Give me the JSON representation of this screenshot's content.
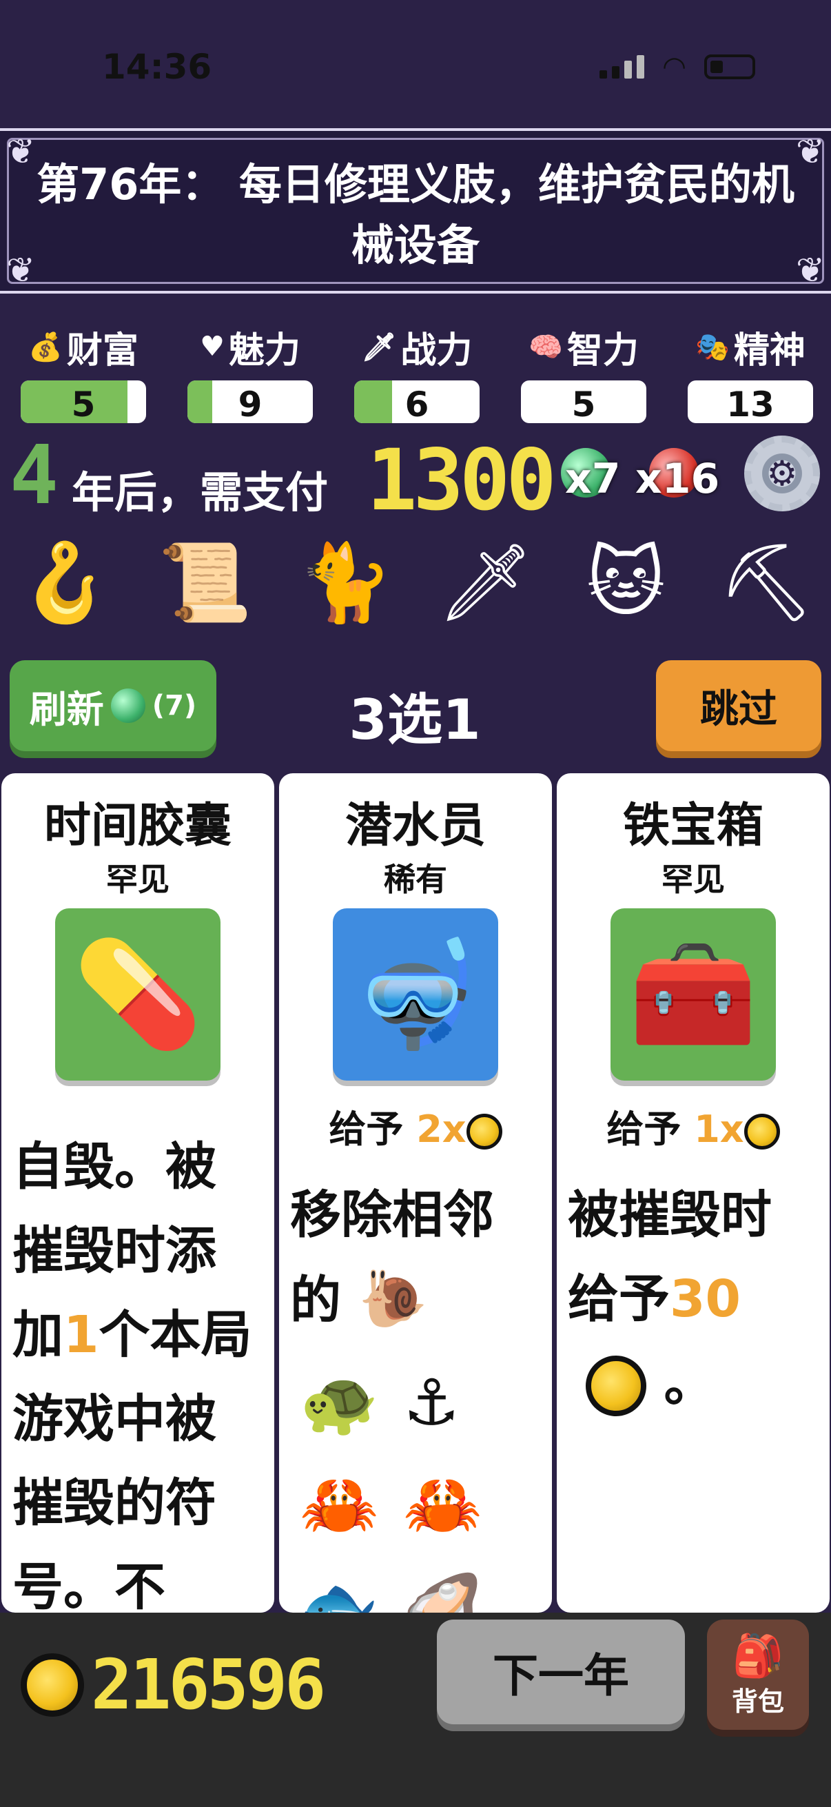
{
  "status_bar": {
    "time": "14:36",
    "icons": [
      "signal-icon",
      "wifi-icon",
      "battery-icon"
    ]
  },
  "banner": {
    "title": "第76年： 每日修理义肢，维护贫民的机械设备"
  },
  "stats": [
    {
      "label": "财富",
      "icon": "money-bag-icon",
      "value": "5",
      "fill_fraction": 0.85
    },
    {
      "label": "魅力",
      "icon": "heart-icon",
      "value": "9",
      "fill_fraction": 0.2
    },
    {
      "label": "战力",
      "icon": "sword-icon",
      "value": "6",
      "fill_fraction": 0.3
    },
    {
      "label": "智力",
      "icon": "brain-icon",
      "value": "5",
      "fill_fraction": 0
    },
    {
      "label": "精神",
      "icon": "mask-icon",
      "value": "13",
      "fill_fraction": 0
    }
  ],
  "payment": {
    "years": "4",
    "text": "年后，需支付",
    "amount": "1300",
    "green_multiplier": "x7",
    "red_multiplier": "x16"
  },
  "items": [
    {
      "name": "hook-tool-icon",
      "glyph": "🪝"
    },
    {
      "name": "wanted-poster-icon",
      "glyph": "📜"
    },
    {
      "name": "cyber-cat-icon",
      "glyph": "🐈"
    },
    {
      "name": "guillotine-icon",
      "glyph": "🗡"
    },
    {
      "name": "lucky-cat-icon",
      "glyph": "🐱"
    },
    {
      "name": "shovel-icon",
      "glyph": "⛏"
    }
  ],
  "actions": {
    "refresh_label": "刷新",
    "refresh_count": "(7)",
    "choose_label": "3选1",
    "skip_label": "跳过"
  },
  "cards": [
    {
      "title": "时间胶囊",
      "rarity": "罕见",
      "image_icon": "capsule-icon",
      "image_glyph": "💊",
      "give": null,
      "desc_parts": [
        "自毁。被摧毁时添加",
        "1",
        "个本局游戏中被摧毁的符号。不"
      ]
    },
    {
      "title": "潜水员",
      "rarity": "稀有",
      "image_icon": "diver-helmet-icon",
      "image_glyph": "🤿",
      "give_prefix": "给予",
      "give_mult": "2x",
      "desc_text": "移除相邻的",
      "symbols": [
        "snail-icon",
        "turtle-icon",
        "anchor-icon",
        "crab-icon",
        "crab-icon",
        "goldfish-icon",
        "oyster-icon"
      ]
    },
    {
      "title": "铁宝箱",
      "rarity": "罕见",
      "image_icon": "treasure-chest-icon",
      "image_glyph": "🧰",
      "give_prefix": "给予",
      "give_mult": "1x",
      "desc_text": "被摧毁时给予",
      "desc_value": "30",
      "desc_end": "。"
    }
  ],
  "bottom": {
    "coins": "216596",
    "next_year_label": "下一年",
    "bag_label": "背包"
  },
  "colors": {
    "background": "#2b2146",
    "accent_green": "#57a64a",
    "accent_orange": "#ee9a34",
    "gold": "#f4e04a"
  }
}
